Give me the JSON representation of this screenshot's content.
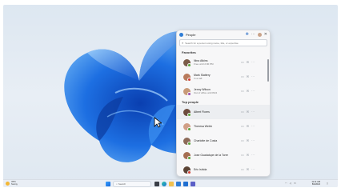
{
  "window": {
    "title": "People"
  },
  "search": {
    "placeholder": "Search for a person using name, title, or expertise"
  },
  "sections": {
    "favorites": "Favorites",
    "top_people": "Top people"
  },
  "favorites": [
    {
      "name": "Nina Atkins",
      "status": "Free until 2:00 PM",
      "avatar_color": "#7a5b48",
      "presence_color": "#5aa33b"
    },
    {
      "name": "Mark Slattery",
      "status": "In a call",
      "avatar_color": "#b87a5c",
      "presence_color": "#d23c32"
    },
    {
      "name": "Jenny Wilson",
      "status": "Out of office until 8/24",
      "avatar_color": "#c89a78",
      "presence_color": "#9b4fb0"
    }
  ],
  "top_people": [
    {
      "name": "Albert Flores",
      "avatar_color": "#6d4c3d",
      "presence_color": "#5aa33b"
    },
    {
      "name": "Theresa Webb",
      "avatar_color": "#d19f86",
      "presence_color": "#5aa33b"
    },
    {
      "name": "Charlotte de Costa",
      "avatar_color": "#8c6a58",
      "presence_color": "#5aa33b"
    },
    {
      "name": "Jose Guadalupe de la Torre",
      "avatar_color": "#a56e52",
      "presence_color": "#5aa33b"
    },
    {
      "name": "Eric Ishida",
      "avatar_color": "#5b4335",
      "presence_color": "#d23c32"
    }
  ],
  "taskbar": {
    "weather_temp": "78°F",
    "weather_desc": "Sunny",
    "search_label": "Search",
    "time": "11:11 AM",
    "date": "8/4/2024"
  },
  "colors": {
    "accent": "#2f7dd6"
  },
  "icons": [
    "people-app-icon",
    "add-person-icon",
    "more-icon",
    "minimize-icon",
    "close-icon",
    "search-icon",
    "chat-icon",
    "mail-icon",
    "more-options-icon",
    "start-icon",
    "task-view-icon",
    "edge-icon",
    "file-explorer-icon",
    "store-icon",
    "mail-app-icon",
    "teams-icon",
    "wifi-icon",
    "volume-icon",
    "battery-icon",
    "notification-icon"
  ]
}
